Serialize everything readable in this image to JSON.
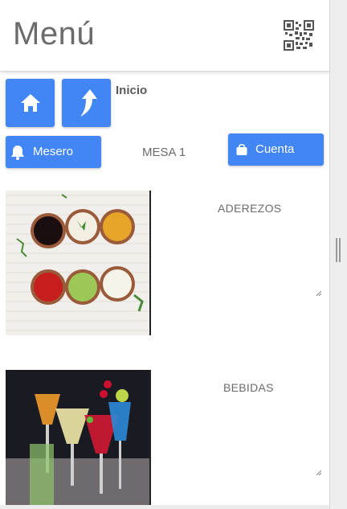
{
  "header": {
    "title": "Menú",
    "qr_icon": "qr-code-icon"
  },
  "nav": {
    "home_icon": "home-icon",
    "up_icon": "arrow-up-icon",
    "inicio_label": "Inicio"
  },
  "actions": {
    "mesero_label": "Mesero",
    "mesero_icon": "bell-icon",
    "mesa_label": "MESA 1",
    "cuenta_label": "Cuenta",
    "cuenta_icon": "shopping-bag-icon"
  },
  "categories": [
    {
      "label": "ADEREZOS"
    },
    {
      "label": "BEBIDAS"
    }
  ],
  "colors": {
    "primary": "#4285f4",
    "text": "#6b6b6b"
  }
}
